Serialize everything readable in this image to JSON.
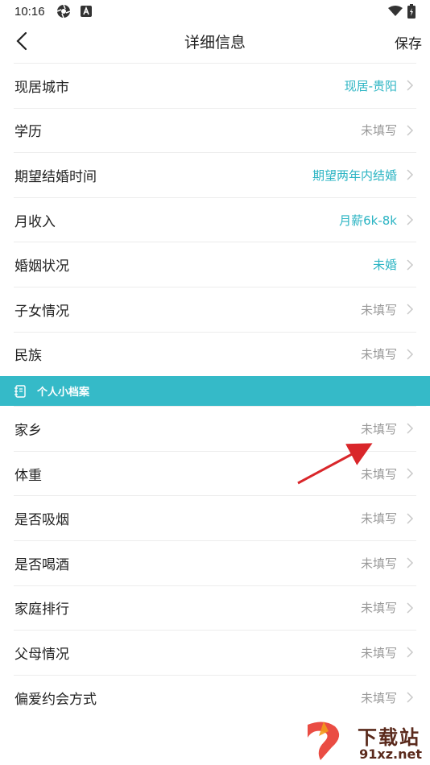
{
  "status_bar": {
    "time": "10:16"
  },
  "nav": {
    "title": "详细信息",
    "save_label": "保存"
  },
  "rows_top": [
    {
      "label": "现居城市",
      "value": "现居-贵阳",
      "filled": true
    },
    {
      "label": "学历",
      "value": "未填写",
      "filled": false
    },
    {
      "label": "期望结婚时间",
      "value": "期望两年内结婚",
      "filled": true
    },
    {
      "label": "月收入",
      "value": "月薪6k-8k",
      "filled": true
    },
    {
      "label": "婚姻状况",
      "value": "未婚",
      "filled": true
    },
    {
      "label": "子女情况",
      "value": "未填写",
      "filled": false
    },
    {
      "label": "民族",
      "value": "未填写",
      "filled": false
    }
  ],
  "section": {
    "title": "个人小档案"
  },
  "rows_bottom": [
    {
      "label": "家乡",
      "value": "未填写",
      "filled": false
    },
    {
      "label": "体重",
      "value": "未填写",
      "filled": false
    },
    {
      "label": "是否吸烟",
      "value": "未填写",
      "filled": false
    },
    {
      "label": "是否喝酒",
      "value": "未填写",
      "filled": false
    },
    {
      "label": "家庭排行",
      "value": "未填写",
      "filled": false
    },
    {
      "label": "父母情况",
      "value": "未填写",
      "filled": false
    },
    {
      "label": "偏爱约会方式",
      "value": "未填写",
      "filled": false
    }
  ],
  "watermark": {
    "top": "下载站",
    "bottom": "91xz.net"
  },
  "colors": {
    "accent": "#35bac8",
    "filled_value": "#2bb4c3",
    "placeholder": "#999999",
    "annotation_arrow": "#d9262a"
  }
}
